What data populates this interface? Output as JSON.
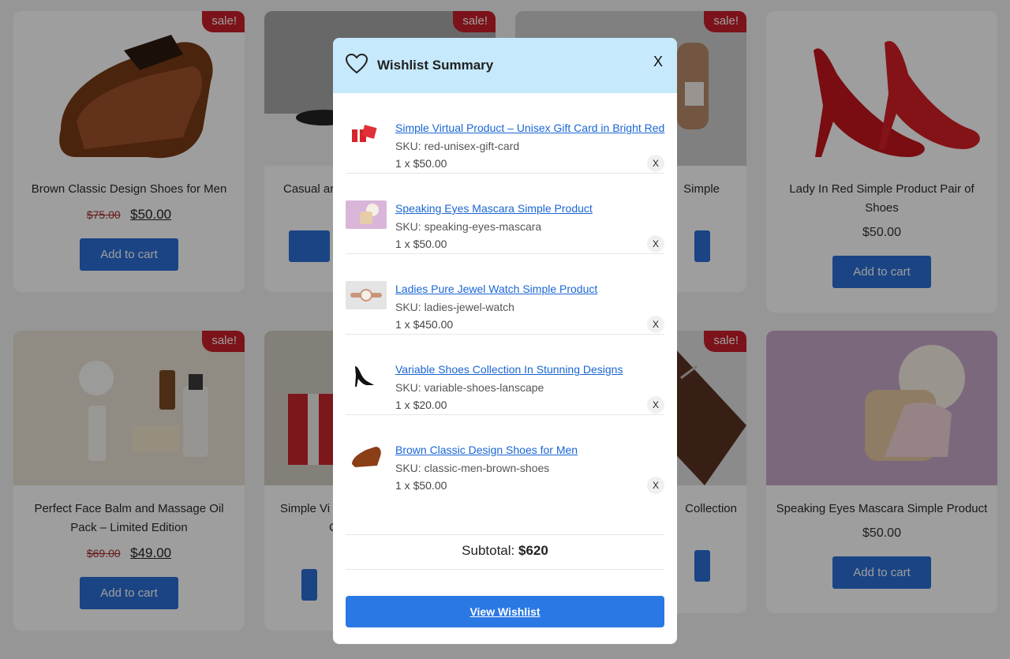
{
  "products": [
    {
      "title": "Brown Classic Design Shoes for Men",
      "old_price": "$75.00",
      "price": "$50.00",
      "sale": "sale!",
      "button": "Add to cart"
    },
    {
      "title": "Casual ar",
      "sale": "sale!",
      "button": ""
    },
    {
      "title": "Simple",
      "sale": "sale!"
    },
    {
      "title": "Lady In Red Simple Product Pair of Shoes",
      "price": "$50.00",
      "button": "Add to cart"
    },
    {
      "title": "Perfect Face Balm and Massage Oil Pack – Limited Edition",
      "old_price": "$69.00",
      "price": "$49.00",
      "sale": "sale!",
      "button": "Add to cart"
    },
    {
      "title": "Simple Vi",
      "subtitle": "C"
    },
    {
      "title": "Collection",
      "sale": "sale!"
    },
    {
      "title": "Speaking Eyes Mascara Simple Product",
      "price": "$50.00",
      "button": "Add to cart"
    }
  ],
  "modal": {
    "title": "Wishlist Summary",
    "close": "X",
    "items": [
      {
        "name": "Simple Virtual Product – Unisex Gift Card in Bright Red",
        "sku": "SKU: red-unisex-gift-card",
        "qty": "1 x $50.00",
        "remove": "X",
        "thumb_icon": "gift-icon"
      },
      {
        "name": "Speaking Eyes Mascara Simple Product",
        "sku": "SKU: speaking-eyes-mascara",
        "qty": "1 x $50.00",
        "remove": "X",
        "thumb_icon": "mascara-icon"
      },
      {
        "name": "Ladies Pure Jewel Watch Simple Product",
        "sku": "SKU: ladies-jewel-watch",
        "qty": "1 x $450.00",
        "remove": "X",
        "thumb_icon": "watch-icon"
      },
      {
        "name": "Variable Shoes Collection In Stunning Designs",
        "sku": "SKU: variable-shoes-lanscape",
        "qty": "1 x $20.00",
        "remove": "X",
        "thumb_icon": "heels-icon"
      },
      {
        "name": "Brown Classic Design Shoes for Men",
        "sku": "SKU: classic-men-brown-shoes",
        "qty": "1 x $50.00",
        "remove": "X",
        "thumb_icon": "shoe-icon"
      }
    ],
    "subtotal_label": "Subtotal:",
    "subtotal_value": "$620",
    "view_button": "View Wishlist"
  },
  "colors": {
    "accent": "#2a78e4",
    "header_bg": "#c6e9fb",
    "sale_badge": "#c81e2a",
    "link": "#1a66d4"
  }
}
